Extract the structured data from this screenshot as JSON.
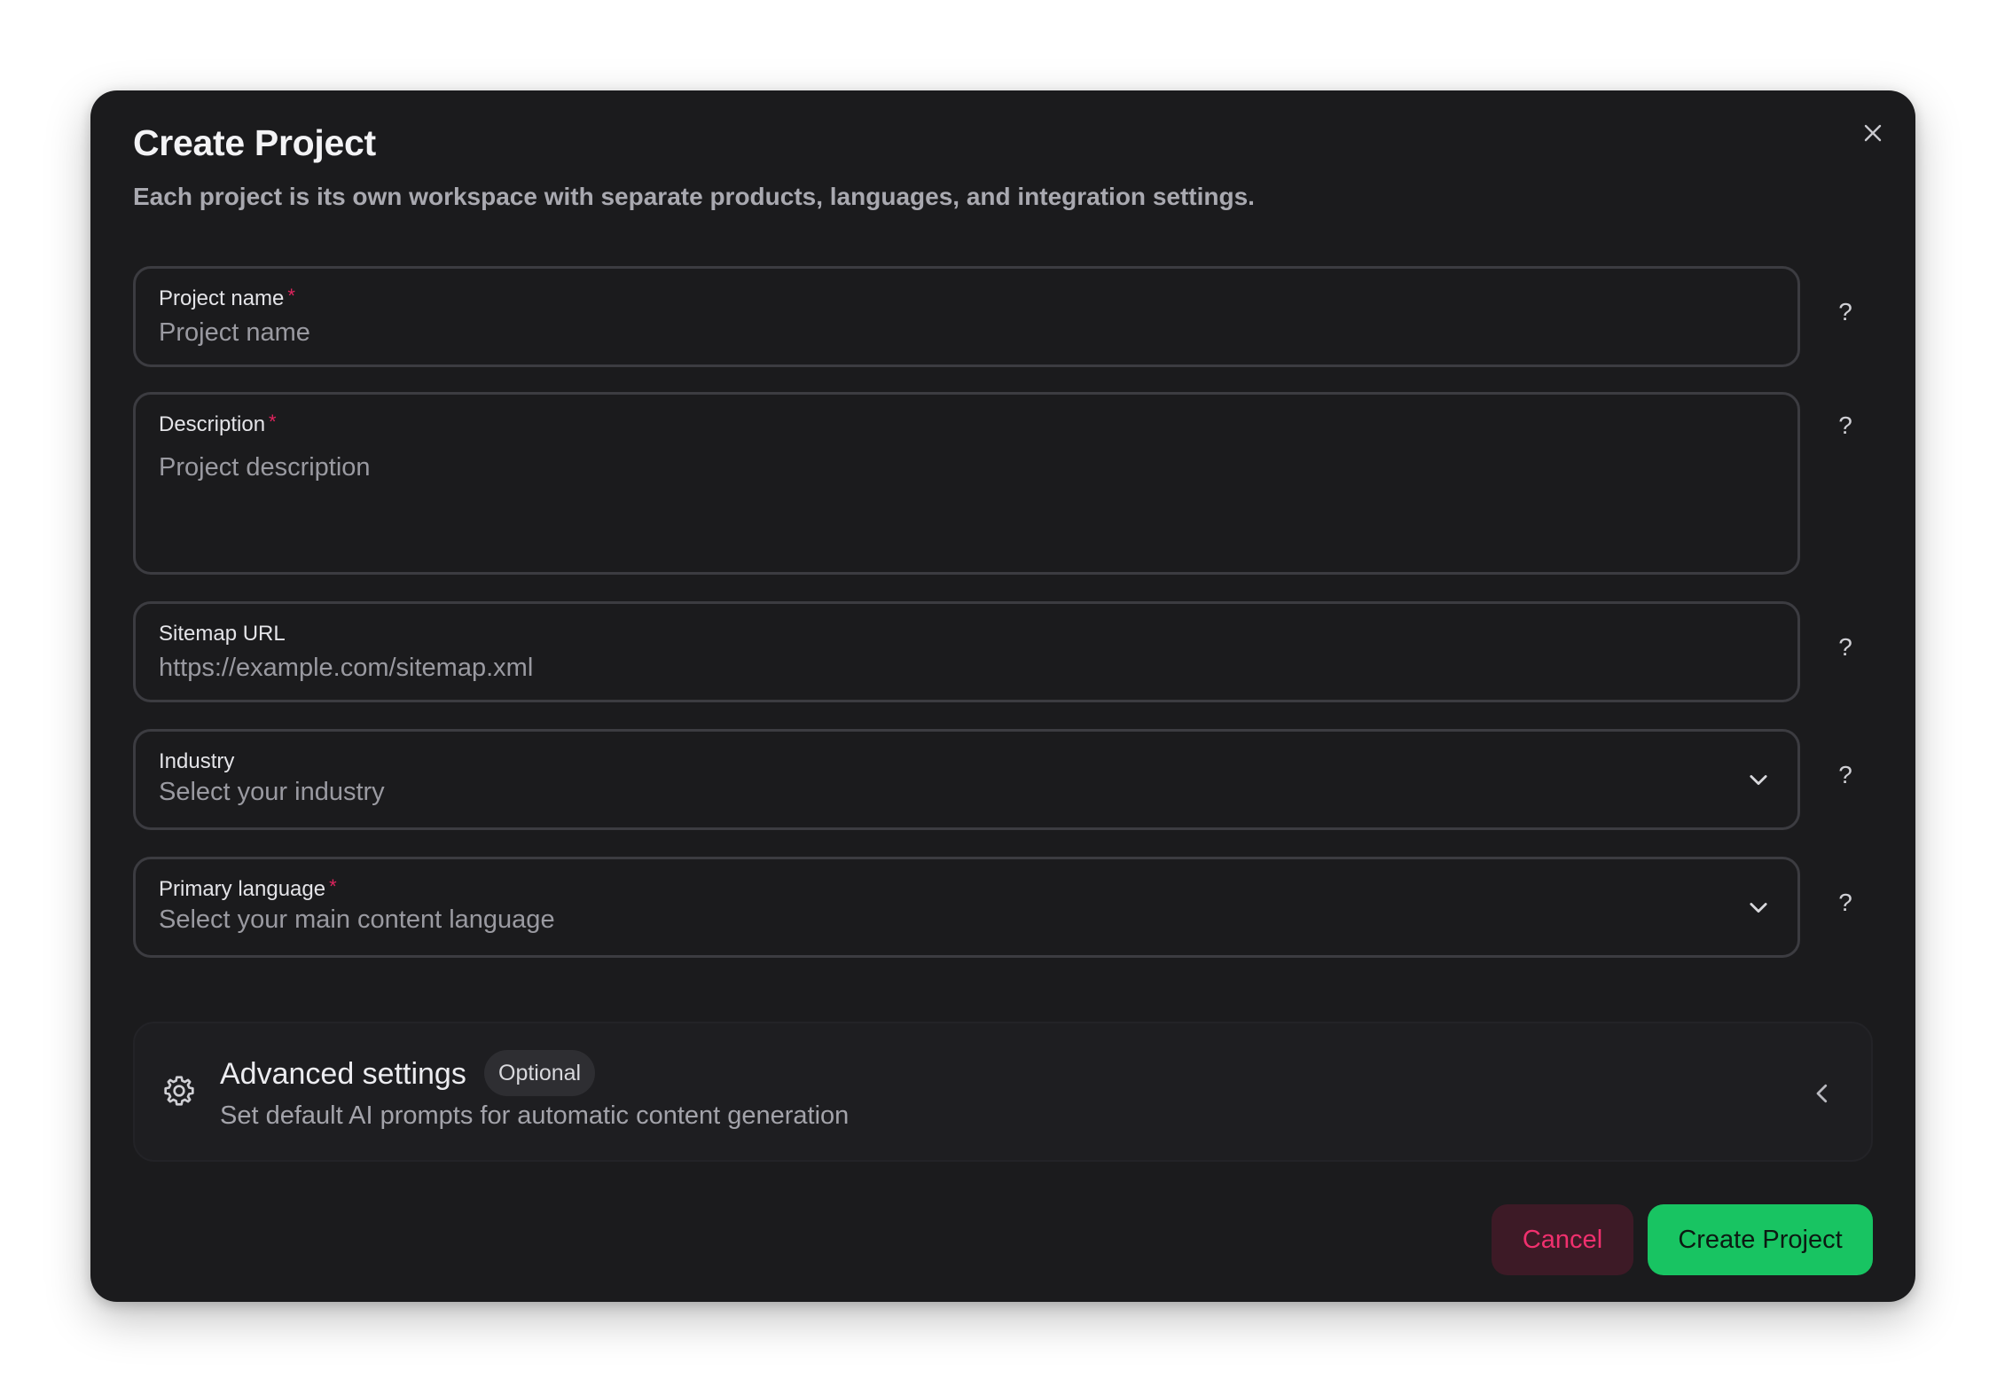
{
  "dialog": {
    "title": "Create Project",
    "subtitle": "Each project is its own workspace with separate products, languages, and integration settings."
  },
  "fields": {
    "project_name": {
      "label": "Project name",
      "required_mark": "*",
      "placeholder": "Project name",
      "value": ""
    },
    "description": {
      "label": "Description",
      "required_mark": "*",
      "placeholder": "Project description",
      "value": ""
    },
    "sitemap_url": {
      "label": "Sitemap URL",
      "placeholder": "https://example.com/sitemap.xml",
      "value": ""
    },
    "industry": {
      "label": "Industry",
      "selected": "Select your industry"
    },
    "primary_language": {
      "label": "Primary language",
      "required_mark": "*",
      "selected": "Select your main content language"
    }
  },
  "help_glyph": "?",
  "advanced": {
    "title": "Advanced settings",
    "badge": "Optional",
    "description": "Set default AI prompts for automatic content generation",
    "icon": "gear-icon",
    "expand_icon": "chevron-left-icon"
  },
  "actions": {
    "cancel_label": "Cancel",
    "create_label": "Create Project"
  },
  "colors": {
    "background": "#1b1b1d",
    "required": "#e0245e",
    "cancel_bg": "#3d1a26",
    "cancel_text": "#f0306e",
    "primary": "#18c462"
  }
}
